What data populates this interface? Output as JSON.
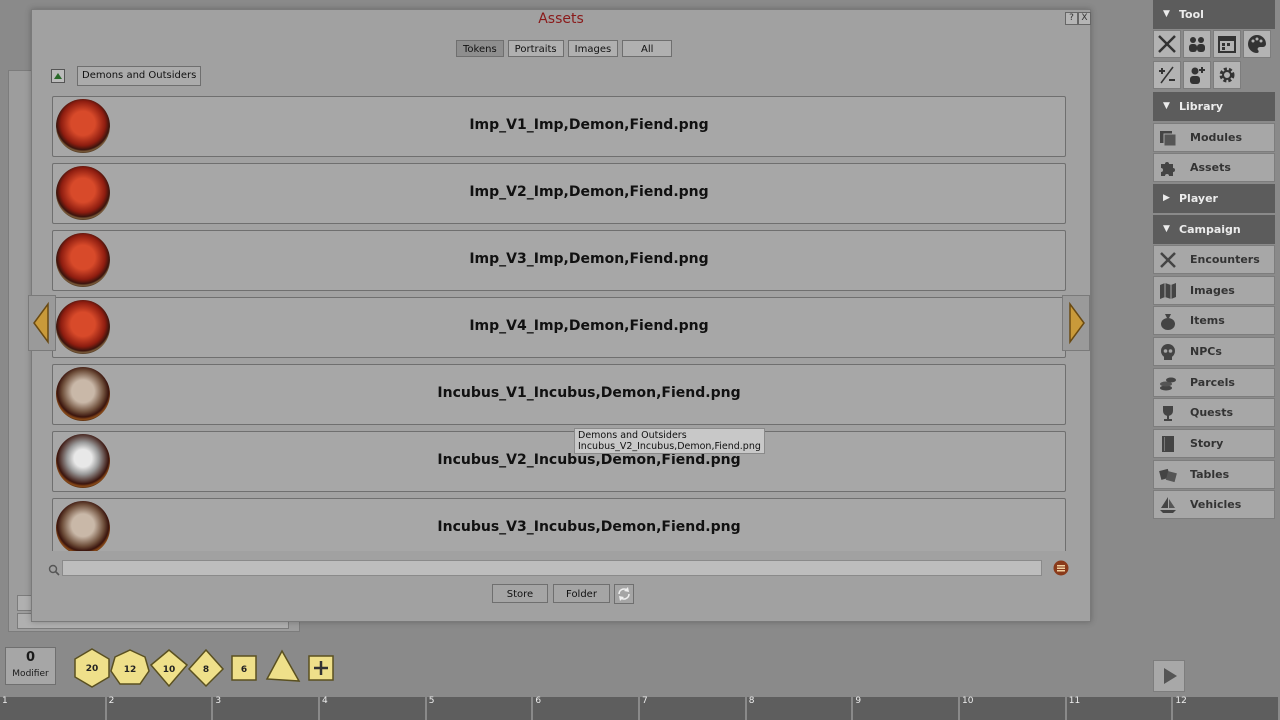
{
  "window": {
    "title": "Assets",
    "help_label": "?",
    "close_label": "X",
    "tabs": [
      {
        "label": "Tokens",
        "active": true
      },
      {
        "label": "Portraits",
        "active": false
      },
      {
        "label": "Images",
        "active": false
      },
      {
        "label": "All",
        "active": false
      }
    ],
    "group_label": "Demons and Outsiders",
    "items": [
      {
        "name": "Imp_V1_Imp,Demon,Fiend.png",
        "thumb": "imp"
      },
      {
        "name": "Imp_V2_Imp,Demon,Fiend.png",
        "thumb": "imp"
      },
      {
        "name": "Imp_V3_Imp,Demon,Fiend.png",
        "thumb": "imp"
      },
      {
        "name": "Imp_V4_Imp,Demon,Fiend.png",
        "thumb": "imp"
      },
      {
        "name": "Incubus_V1_Incubus,Demon,Fiend.png",
        "thumb": "incubus"
      },
      {
        "name": "Incubus_V2_Incubus,Demon,Fiend.png",
        "thumb": "search"
      },
      {
        "name": "Incubus_V3_Incubus,Demon,Fiend.png",
        "thumb": "incubus"
      }
    ],
    "tooltip": {
      "line1": "Demons and Outsiders",
      "line2": "Incubus_V2_Incubus,Demon,Fiend.png"
    },
    "search": {
      "value": "",
      "placeholder": ""
    },
    "buttons": {
      "store": "Store",
      "folder": "Folder"
    }
  },
  "sidebar": {
    "tool_header": "Tool",
    "library_header": "Library",
    "player_header": "Player",
    "campaign_header": "Campaign",
    "library_items": [
      "Modules",
      "Assets"
    ],
    "campaign_items": [
      "Encounters",
      "Images",
      "Items",
      "NPCs",
      "Parcels",
      "Quests",
      "Story",
      "Tables",
      "Vehicles"
    ]
  },
  "bottom": {
    "modifier_value": "0",
    "modifier_label": "Modifier",
    "dice": [
      "20",
      "12",
      "10",
      "8",
      "6"
    ],
    "hotbar_slots": [
      "1",
      "2",
      "3",
      "4",
      "5",
      "6",
      "7",
      "8",
      "9",
      "10",
      "11",
      "12"
    ]
  },
  "colors": {
    "title_red": "#8a1a1a",
    "header_dark": "#5c5c5c",
    "dice_yellow": "#efe08a"
  }
}
